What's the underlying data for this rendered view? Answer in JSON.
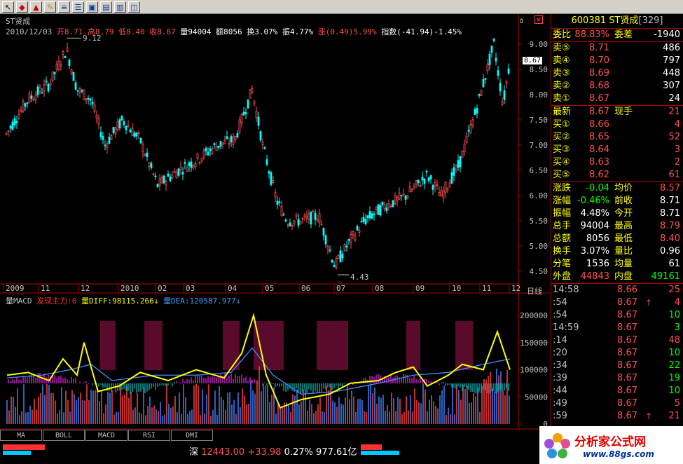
{
  "toolbar": {
    "icons": [
      "arrow-icon",
      "stop-icon",
      "alarm-icon",
      "brush-icon",
      "list-icon",
      "list2-icon",
      "snapshot-icon",
      "image-icon",
      "image2-icon",
      "chart-icon"
    ]
  },
  "header": {
    "name": "ST贤成",
    "date": "2010/12/03",
    "items": [
      {
        "label": "开",
        "value": "8.71"
      },
      {
        "label": "高",
        "value": "8.79"
      },
      {
        "label": "低",
        "value": "8.40"
      },
      {
        "label": "收",
        "value": "8.67"
      },
      {
        "label": "量",
        "value": "94004"
      },
      {
        "label": "额",
        "value": "8056"
      },
      {
        "label": "换",
        "value": "3.07%"
      },
      {
        "label": "振",
        "value": "4.77%"
      },
      {
        "label": "涨",
        "value": "(0.49)5.99%"
      },
      {
        "label": "指数",
        "value": "(-41.94)-1.45%"
      }
    ]
  },
  "price_axis": [
    "9.00",
    "8.50",
    "8.00",
    "7.50",
    "7.00",
    "6.50",
    "6.00",
    "5.50",
    "5.00",
    "4.50"
  ],
  "current_price_tag": "8.67",
  "high_label": "9.12",
  "low_label": "4.43",
  "time_axis": [
    "2009",
    "11",
    "12",
    "2010",
    "02",
    "03",
    "04",
    "05",
    "06",
    "07",
    "08",
    "09",
    "10",
    "11",
    "12"
  ],
  "period_label": "日线",
  "indicator": {
    "title": "量MACD",
    "main_force": "发现主力:0",
    "diff": "量DIFF:98115.266",
    "dea": "量DEA:120587.977",
    "axis": [
      "200000",
      "150000",
      "100000",
      "50000",
      "0"
    ]
  },
  "tabs": [
    "MA",
    "BOLL",
    "MACD",
    "RSI",
    "DMI"
  ],
  "panel": {
    "code": "600381",
    "name": "ST贤成",
    "rank": "[329]",
    "webi": {
      "label": "委比",
      "value": "88.83%",
      "label2": "委差",
      "value2": "-1940"
    },
    "sells": [
      {
        "label": "卖⑤",
        "price": "8.71",
        "vol": "486"
      },
      {
        "label": "卖④",
        "price": "8.70",
        "vol": "797"
      },
      {
        "label": "卖③",
        "price": "8.69",
        "vol": "448"
      },
      {
        "label": "卖②",
        "price": "8.68",
        "vol": "307"
      },
      {
        "label": "卖①",
        "price": "8.67",
        "vol": "24"
      }
    ],
    "latest": {
      "label": "最新",
      "price": "8.67",
      "label2": "现手",
      "vol": "21"
    },
    "buys": [
      {
        "label": "买①",
        "price": "8.66",
        "vol": "4"
      },
      {
        "label": "买②",
        "price": "8.65",
        "vol": "52"
      },
      {
        "label": "买③",
        "price": "8.64",
        "vol": "3"
      },
      {
        "label": "买④",
        "price": "8.63",
        "vol": "2"
      },
      {
        "label": "买⑤",
        "price": "8.62",
        "vol": "61"
      }
    ],
    "stats": [
      {
        "l1": "涨跌",
        "v1": "-0.04",
        "l2": "均价",
        "v2": "8.57",
        "c1": "#00ff00",
        "c2": "#ff5050"
      },
      {
        "l1": "涨幅",
        "v1": "-0.46%",
        "l2": "前收",
        "v2": "8.71",
        "c1": "#00ff00",
        "c2": "#ffffff"
      },
      {
        "l1": "振幅",
        "v1": "4.48%",
        "l2": "今开",
        "v2": "8.71",
        "c1": "#ffffff",
        "c2": "#ffffff"
      },
      {
        "l1": "总手",
        "v1": "94004",
        "l2": "最高",
        "v2": "8.79",
        "c1": "#ffffff",
        "c2": "#ff5050"
      },
      {
        "l1": "总额",
        "v1": "8056",
        "l2": "最低",
        "v2": "8.40",
        "c1": "#ffffff",
        "c2": "#ff5050"
      },
      {
        "l1": "换手",
        "v1": "3.07%",
        "l2": "量比",
        "v2": "0.96",
        "c1": "#ffffff",
        "c2": "#ffffff"
      },
      {
        "l1": "分笔",
        "v1": "1536",
        "l2": "均量",
        "v2": "61",
        "c1": "#ffffff",
        "c2": "#ffffff"
      },
      {
        "l1": "外盘",
        "v1": "44843",
        "l2": "内盘",
        "v2": "49161",
        "c1": "#ff5050",
        "c2": "#00ff00"
      }
    ],
    "ticks": [
      {
        "time": "14:58",
        "price": "8.66",
        "arrow": "",
        "vol": "25",
        "vc": "#ff5050"
      },
      {
        "time": ":54",
        "price": "8.67",
        "arrow": "↑",
        "vol": "4",
        "vc": "#ff5050"
      },
      {
        "time": ":54",
        "price": "8.67",
        "arrow": "",
        "vol": "10",
        "vc": "#00ff00"
      },
      {
        "time": "14:59",
        "price": "8.67",
        "arrow": "",
        "vol": "3",
        "vc": "#00ff00"
      },
      {
        "time": ":14",
        "price": "8.67",
        "arrow": "",
        "vol": "48",
        "vc": "#ff5050"
      },
      {
        "time": ":20",
        "price": "8.67",
        "arrow": "",
        "vol": "10",
        "vc": "#00ff00"
      },
      {
        "time": ":34",
        "price": "8.67",
        "arrow": "",
        "vol": "22",
        "vc": "#00ff00"
      },
      {
        "time": ":39",
        "price": "8.67",
        "arrow": "",
        "vol": "19",
        "vc": "#00ff00"
      },
      {
        "time": ":44",
        "price": "8.67",
        "arrow": "",
        "vol": "10",
        "vc": "#00ff00"
      },
      {
        "time": ":49",
        "price": "8.67",
        "arrow": "",
        "vol": "5",
        "vc": "#ff5050"
      },
      {
        "time": ":59",
        "price": "8.67",
        "arrow": "↑",
        "vol": "21",
        "vc": "#ff5050"
      }
    ]
  },
  "status": {
    "market": "深",
    "index": "12443.00",
    "change": "+33.98",
    "pct": "0.27%",
    "amount": "977.61亿"
  },
  "logo": {
    "name": "分析家公式网",
    "url": "www.88gs.com"
  },
  "colors": {
    "up": "#ff5050",
    "down": "#00ffff",
    "grid": "#b00000",
    "label": "#ffff00"
  }
}
